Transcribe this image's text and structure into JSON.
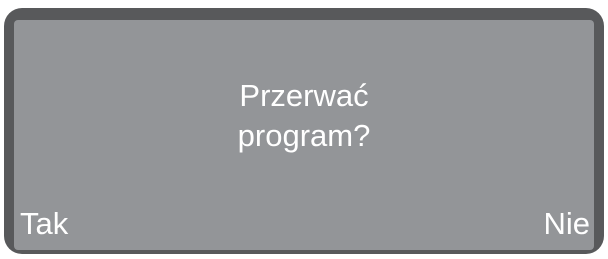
{
  "dialog": {
    "message_line1": "Przerwać",
    "message_line2": "program?",
    "confirm_label": "Tak",
    "cancel_label": "Nie"
  },
  "colors": {
    "bezel": "#58595b",
    "screen": "#939598",
    "text": "#ffffff"
  }
}
